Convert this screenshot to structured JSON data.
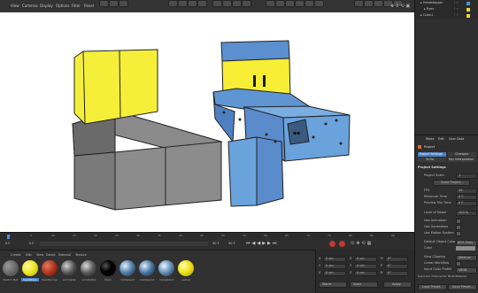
{
  "menu": [
    "View",
    "Cameras",
    "Display",
    "Options",
    "Filter",
    "Panel"
  ],
  "objects": [
    "Headstopper",
    "Eyes",
    "Cube.L"
  ],
  "attributes": {
    "tabs": [
      "Mode",
      "Edit",
      "User Data"
    ],
    "project_label": "Project",
    "subtabs": [
      "Project Settings",
      "Cineware",
      "To Do",
      "Key Interpolation"
    ],
    "section_title": "Project Settings",
    "project_scale_label": "Project Scale",
    "project_scale_value": "1",
    "scale_project_button": "Scale Project...",
    "rows": [
      {
        "label": "FPS",
        "value": "30"
      },
      {
        "label": "Minimum Time",
        "value": "0 F"
      },
      {
        "label": "Preview Min Time",
        "value": "0 F"
      },
      {
        "label": "Level of Detail",
        "value": "100 %"
      },
      {
        "label": "Use Animation",
        "value": ""
      },
      {
        "label": "Use Generators",
        "value": ""
      },
      {
        "label": "Use Motion System",
        "value": ""
      },
      {
        "label": "Default Object Color",
        "value": "80% Gray"
      },
      {
        "label": "Color",
        "value": ""
      },
      {
        "label": "View Clipping",
        "value": "Medium"
      },
      {
        "label": "Linear Workflow",
        "value": ""
      },
      {
        "label": "Input Color Profile",
        "value": "sRGB"
      },
      {
        "label": "Use Color Channel for Node Material",
        "value": ""
      }
    ],
    "footer_buttons": [
      "Load Preset...",
      "Save Preset..."
    ]
  },
  "timeline": {
    "ticks": [
      "0",
      "5",
      "10",
      "15",
      "20",
      "25",
      "30",
      "35",
      "40",
      "45",
      "50",
      "55",
      "60",
      "65",
      "70",
      "75",
      "80",
      "85",
      "90"
    ],
    "current_frame": "0 F",
    "start_field": "0 F",
    "end_field_a": "90 F",
    "end_field_b": "90 F"
  },
  "material_menu": [
    "Create",
    "Edit",
    "View",
    "Select",
    "Material",
    "Texture"
  ],
  "materials": [
    {
      "name": "Sketch Mat",
      "color": "#6a6a6a"
    },
    {
      "name": "headstopp",
      "color": "#f0e82a"
    },
    {
      "name": "headbackgr",
      "color": "#b0341f"
    },
    {
      "name": "vertmetal",
      "color": "#555"
    },
    {
      "name": "unmetaltel",
      "color": "#5a5a5a"
    },
    {
      "name": "black",
      "color": "#000"
    },
    {
      "name": "metalpaint",
      "color": "#5a86b0"
    },
    {
      "name": "metalpaint",
      "color": "#4f7da7"
    },
    {
      "name": "metalpaint",
      "color": "#6a94bb"
    },
    {
      "name": "yellow",
      "color": "#f2e31b"
    }
  ],
  "coords": {
    "rows": [
      {
        "a": "X",
        "av": "0 cm",
        "b": "X",
        "bv": "0 cm",
        "c": "H",
        "cv": "0°"
      },
      {
        "a": "Y",
        "av": "0 cm",
        "b": "Y",
        "bv": "0 cm",
        "c": "P",
        "cv": "0°"
      },
      {
        "a": "Z",
        "av": "0 cm",
        "b": "Z",
        "bv": "0 cm",
        "c": "B",
        "cv": "0°"
      }
    ],
    "world_label": "World",
    "scale_label": "Scale",
    "apply_label": "Apply"
  }
}
